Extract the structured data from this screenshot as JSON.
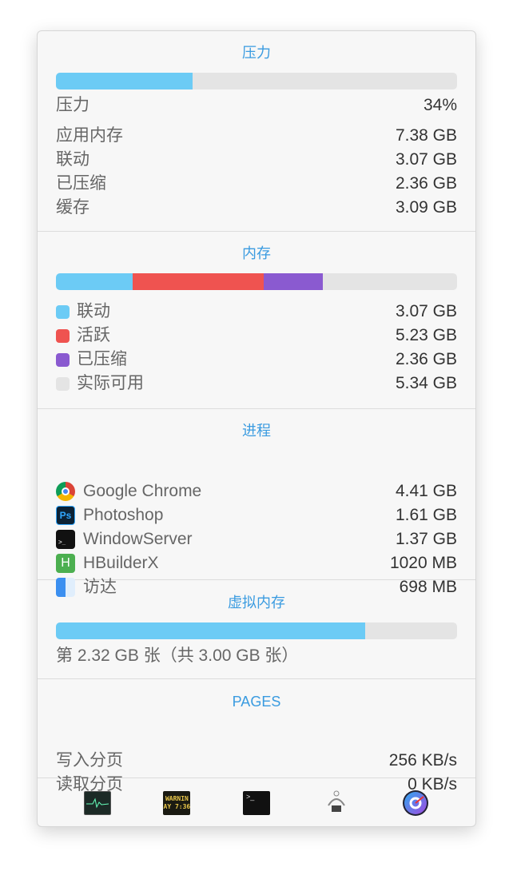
{
  "pressure": {
    "title": "压力",
    "level_percent": 34,
    "colors": {
      "fill": "#6ccbf5"
    },
    "rows": [
      {
        "label": "压力",
        "value": "34%"
      },
      {
        "label": "应用内存",
        "value": "7.38 GB"
      },
      {
        "label": "联动",
        "value": "3.07 GB"
      },
      {
        "label": "已压缩",
        "value": "2.36 GB"
      },
      {
        "label": "缓存",
        "value": "3.09 GB"
      }
    ]
  },
  "memory": {
    "title": "内存",
    "rows": [
      {
        "label": "联动",
        "value": "3.07 GB",
        "gb": 3.07,
        "color": "#6ccbf5"
      },
      {
        "label": "活跃",
        "value": "5.23 GB",
        "gb": 5.23,
        "color": "#ef5350"
      },
      {
        "label": "已压缩",
        "value": "2.36 GB",
        "gb": 2.36,
        "color": "#8a5ad0"
      },
      {
        "label": "实际可用",
        "value": "5.34 GB",
        "gb": 5.34,
        "color": "#e4e4e4"
      }
    ]
  },
  "processes": {
    "title": "进程",
    "rows": [
      {
        "label": "Google Chrome",
        "value": "4.41 GB",
        "icon": "chrome-icon"
      },
      {
        "label": "Photoshop",
        "value": "1.61 GB",
        "icon": "photoshop-icon",
        "icon_text": "Ps"
      },
      {
        "label": "WindowServer",
        "value": "1.37 GB",
        "icon": "terminal-icon"
      },
      {
        "label": "HBuilderX",
        "value": "1020 MB",
        "icon": "hbuilderx-icon",
        "icon_text": "H"
      },
      {
        "label": "访达",
        "value": "698 MB",
        "icon": "finder-icon"
      }
    ]
  },
  "virtual": {
    "title": "虚拟内存",
    "used_fraction": 0.77,
    "text": "第 2.32 GB 张（共 3.00 GB 张）"
  },
  "pages": {
    "title": "PAGES",
    "rows": [
      {
        "label": "写入分页",
        "value": "256 KB/s"
      },
      {
        "label": "读取分页",
        "value": "0 KB/s"
      }
    ]
  },
  "dock": [
    {
      "name": "activity-monitor-icon"
    },
    {
      "name": "console-icon",
      "logo_text": "WARNIN AY 7:36"
    },
    {
      "name": "terminal-icon",
      "logo_text": ">_"
    },
    {
      "name": "memory-cleaner-icon"
    },
    {
      "name": "istat-icon"
    }
  ]
}
